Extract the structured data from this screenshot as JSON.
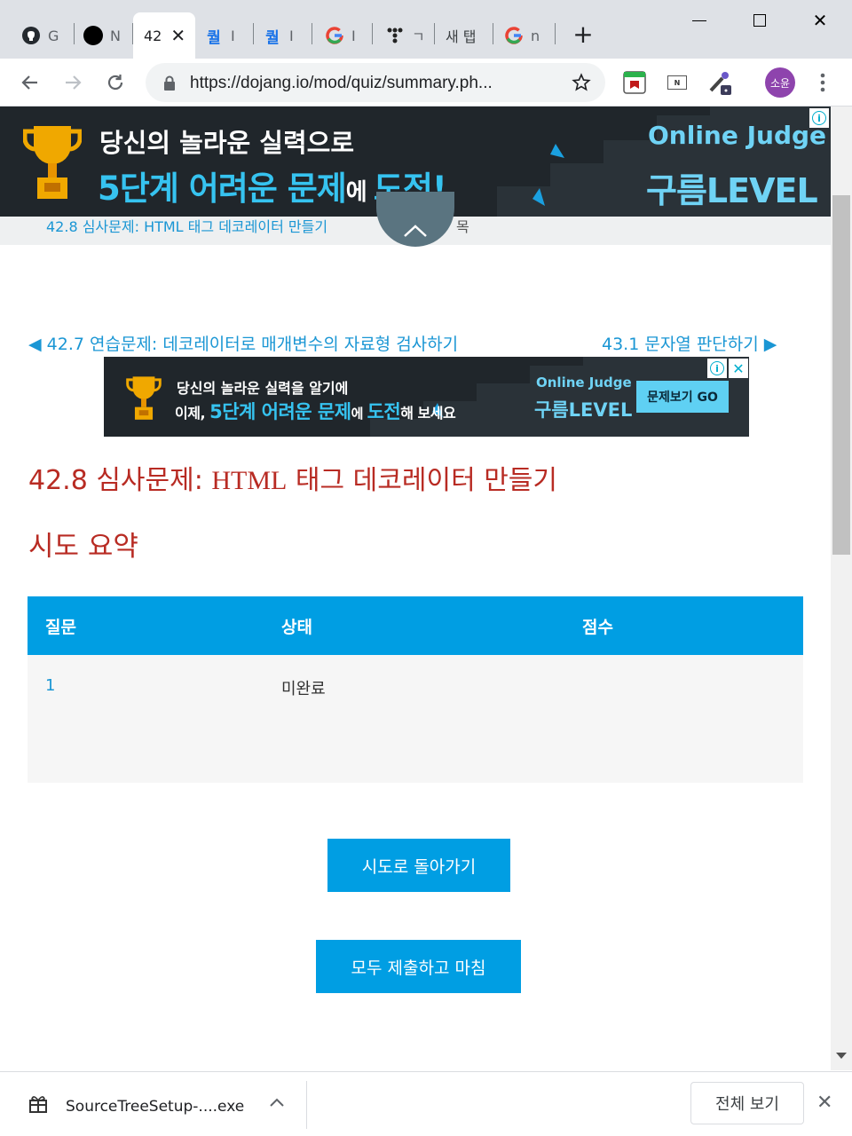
{
  "browser": {
    "tabs": [
      {
        "icon": "github-icon",
        "label": "G"
      },
      {
        "icon": "circle-icon",
        "label": "N"
      },
      {
        "icon": "",
        "label": "42",
        "active": true
      },
      {
        "icon": "quiz-icon",
        "label": "I"
      },
      {
        "icon": "quiz-icon",
        "label": "I"
      },
      {
        "icon": "google-icon",
        "label": "I"
      },
      {
        "icon": "dots-icon",
        "label": "ㄱ"
      },
      {
        "icon": "",
        "label": "새 탭"
      },
      {
        "icon": "google-icon",
        "label": "n"
      }
    ],
    "tab_icon_text": "퀄",
    "new_tab": "+",
    "url": "https://dojang.io/mod/quiz/summary.ph...",
    "profile_initials": "소윤",
    "ext_badge": "N"
  },
  "ads": {
    "top": {
      "line1": "당신의 놀라운 실력으로",
      "line2a": "5단계 어려운 문제",
      "line2b": "에 ",
      "line2c": "도전!",
      "brand1": "Online Judge",
      "brand2": "구름LEVEL"
    },
    "mid": {
      "line1": "당신의 놀라운 실력을 알기에",
      "line2a": "이제, ",
      "line2b": "5단계 어려운 문제",
      "line2c": "에 ",
      "line2d": "도전",
      "line2e": "해 보세요",
      "brand1": "Online Judge",
      "brand2": "구름LEVEL",
      "cta": "문제보기 GO"
    }
  },
  "subnav_text": "42.8 심사문제: HTML 태그 데코레이터 만들기",
  "subnav_tail": "목",
  "nav": {
    "prev": "◀ 42.7 연습문제: 데코레이터로 매개변수의 자료형 검사하기",
    "next": "43.1 문자열 판단하기 ▶"
  },
  "page": {
    "title_num": "42.8 심사문제: ",
    "title_html": "HTML",
    "title_rest": " 태그 데코레이터 만들기",
    "subtitle": "시도 요약"
  },
  "table": {
    "headers": [
      "질문",
      "상태",
      "점수"
    ],
    "rows": [
      {
        "q": "1",
        "status": "미완료",
        "score": ""
      }
    ]
  },
  "buttons": {
    "back": "시도로 돌아가기",
    "submit": "모두 제출하고 마침"
  },
  "download": {
    "filename": "SourceTreeSetup-....exe",
    "show_all": "전체 보기"
  },
  "colors": {
    "accent": "#009ee3",
    "title": "#b82b23",
    "link": "#1a96d4"
  }
}
